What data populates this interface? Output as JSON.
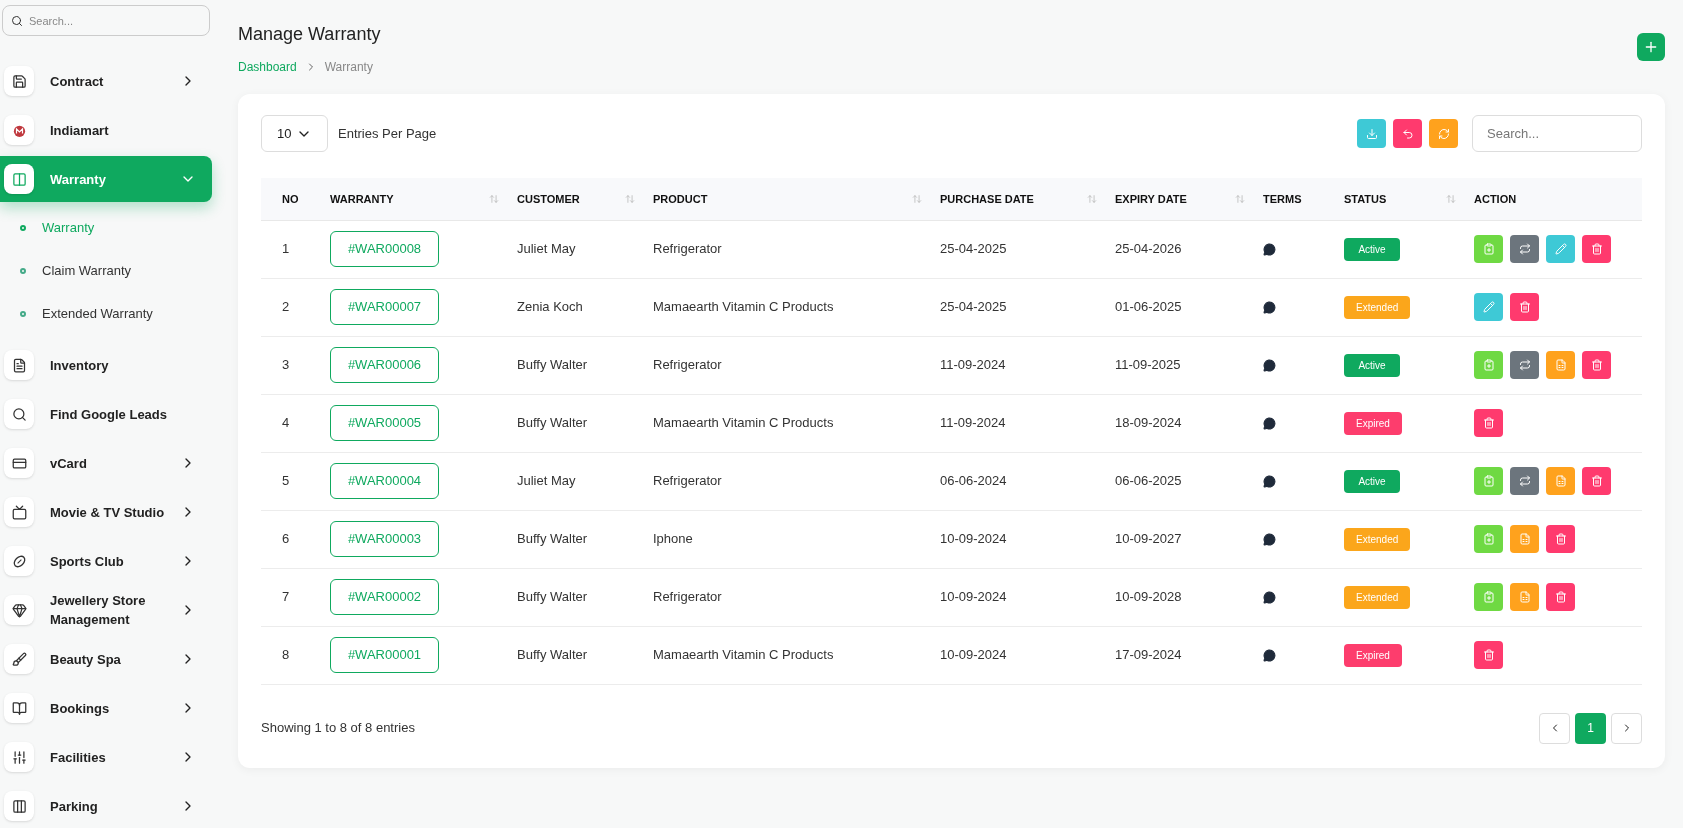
{
  "sidebar": {
    "search": {
      "placeholder": "Search..."
    },
    "items": [
      {
        "label": "Contract",
        "expandable": true,
        "expanded": false,
        "selected": false
      },
      {
        "label": "Indiamart",
        "expandable": false,
        "selected": false
      },
      {
        "label": "Warranty",
        "expandable": true,
        "expanded": true,
        "selected": true,
        "children": [
          {
            "label": "Warranty",
            "selected": true
          },
          {
            "label": "Claim Warranty",
            "selected": false
          },
          {
            "label": "Extended Warranty",
            "selected": false
          }
        ]
      },
      {
        "label": "Inventory",
        "expandable": false,
        "selected": false
      },
      {
        "label": "Find Google Leads",
        "expandable": false,
        "selected": false
      },
      {
        "label": "vCard",
        "expandable": true,
        "expanded": false,
        "selected": false
      },
      {
        "label": "Movie & TV Studio",
        "expandable": true,
        "expanded": false,
        "selected": false
      },
      {
        "label": "Sports Club",
        "expandable": true,
        "expanded": false,
        "selected": false
      },
      {
        "label": "Jewellery Store Management",
        "expandable": true,
        "expanded": false,
        "selected": false
      },
      {
        "label": "Beauty Spa",
        "expandable": true,
        "expanded": false,
        "selected": false
      },
      {
        "label": "Bookings",
        "expandable": true,
        "expanded": false,
        "selected": false
      },
      {
        "label": "Facilities",
        "expandable": true,
        "expanded": false,
        "selected": false
      },
      {
        "label": "Parking",
        "expandable": true,
        "expanded": false,
        "selected": false
      }
    ]
  },
  "header": {
    "title": "Manage Warranty",
    "breadcrumb": [
      "Dashboard",
      "Warranty"
    ]
  },
  "toolbar": {
    "page_size": "10",
    "page_size_label": "Entries Per Page",
    "search": {
      "placeholder": "Search..."
    }
  },
  "table": {
    "columns": [
      {
        "label": "NO",
        "sortable": false
      },
      {
        "label": "WARRANTY",
        "sortable": true
      },
      {
        "label": "CUSTOMER",
        "sortable": true
      },
      {
        "label": "PRODUCT",
        "sortable": true
      },
      {
        "label": "PURCHASE DATE",
        "sortable": true
      },
      {
        "label": "EXPIRY DATE",
        "sortable": true
      },
      {
        "label": "TERMS",
        "sortable": false
      },
      {
        "label": "STATUS",
        "sortable": true
      },
      {
        "label": "ACTION",
        "sortable": false
      }
    ],
    "rows": [
      {
        "no": "1",
        "warranty": "#WAR00008",
        "customer": "Juliet May",
        "product": "Refrigerator",
        "purchase_date": "25-04-2025",
        "expiry_date": "25-04-2026",
        "status": {
          "label": "Active",
          "kind": "active"
        },
        "actions": [
          {
            "kind": "claim"
          },
          {
            "kind": "transfer"
          },
          {
            "kind": "edit"
          },
          {
            "kind": "delete"
          }
        ]
      },
      {
        "no": "2",
        "warranty": "#WAR00007",
        "customer": "Zenia Koch",
        "product": "Mamaearth Vitamin C Products",
        "purchase_date": "25-04-2025",
        "expiry_date": "01-06-2025",
        "status": {
          "label": "Extended",
          "kind": "extended"
        },
        "actions": [
          {
            "kind": "edit"
          },
          {
            "kind": "delete"
          }
        ]
      },
      {
        "no": "3",
        "warranty": "#WAR00006",
        "customer": "Buffy Walter",
        "product": "Refrigerator",
        "purchase_date": "11-09-2024",
        "expiry_date": "11-09-2025",
        "status": {
          "label": "Active",
          "kind": "active"
        },
        "actions": [
          {
            "kind": "claim"
          },
          {
            "kind": "transfer"
          },
          {
            "kind": "invoice"
          },
          {
            "kind": "delete"
          }
        ]
      },
      {
        "no": "4",
        "warranty": "#WAR00005",
        "customer": "Buffy Walter",
        "product": "Mamaearth Vitamin C Products",
        "purchase_date": "11-09-2024",
        "expiry_date": "18-09-2024",
        "status": {
          "label": "Expired",
          "kind": "expired"
        },
        "actions": [
          {
            "kind": "delete"
          }
        ]
      },
      {
        "no": "5",
        "warranty": "#WAR00004",
        "customer": "Juliet May",
        "product": "Refrigerator",
        "purchase_date": "06-06-2024",
        "expiry_date": "06-06-2025",
        "status": {
          "label": "Active",
          "kind": "active"
        },
        "actions": [
          {
            "kind": "claim"
          },
          {
            "kind": "transfer"
          },
          {
            "kind": "invoice"
          },
          {
            "kind": "delete"
          }
        ]
      },
      {
        "no": "6",
        "warranty": "#WAR00003",
        "customer": "Buffy Walter",
        "product": "Iphone",
        "purchase_date": "10-09-2024",
        "expiry_date": "10-09-2027",
        "status": {
          "label": "Extended",
          "kind": "extended"
        },
        "actions": [
          {
            "kind": "claim"
          },
          {
            "kind": "invoice"
          },
          {
            "kind": "delete"
          }
        ]
      },
      {
        "no": "7",
        "warranty": "#WAR00002",
        "customer": "Buffy Walter",
        "product": "Refrigerator",
        "purchase_date": "10-09-2024",
        "expiry_date": "10-09-2028",
        "status": {
          "label": "Extended",
          "kind": "extended"
        },
        "actions": [
          {
            "kind": "claim"
          },
          {
            "kind": "invoice"
          },
          {
            "kind": "delete"
          }
        ]
      },
      {
        "no": "8",
        "warranty": "#WAR00001",
        "customer": "Buffy Walter",
        "product": "Mamaearth Vitamin C Products",
        "purchase_date": "10-09-2024",
        "expiry_date": "17-09-2024",
        "status": {
          "label": "Expired",
          "kind": "expired"
        },
        "actions": [
          {
            "kind": "delete"
          }
        ]
      }
    ]
  },
  "footer": {
    "summary": "Showing 1 to 8 of 8 entries",
    "pages": [
      {
        "label": "1",
        "selected": true
      }
    ]
  }
}
